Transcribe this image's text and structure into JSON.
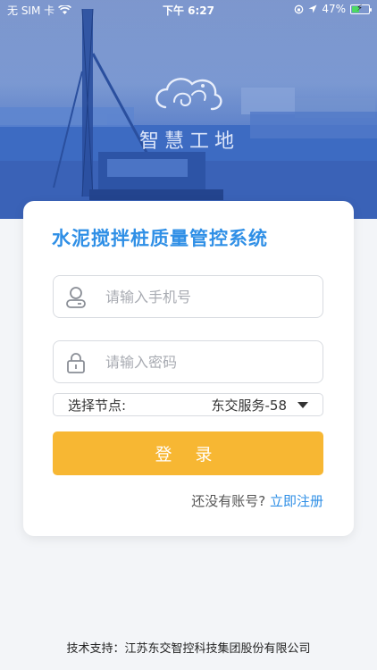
{
  "status_bar": {
    "carrier": "无 SIM 卡",
    "time": "下午 6:27",
    "battery": "47%",
    "battery_level": 0.47
  },
  "hero": {
    "brand_text": "智慧工地",
    "logo_icon": "cloud-swirl-icon"
  },
  "login": {
    "title": "水泥搅拌桩质量管控系统",
    "phone_placeholder": "请输入手机号",
    "password_placeholder": "请输入密码",
    "node_label": "选择节点:",
    "node_value": "东交服务-58",
    "login_button": "登 录",
    "no_account_text": "还没有账号?",
    "register_link": "立即注册"
  },
  "footer": {
    "support_text": "技术支持：江苏东交智控科技集团股份有限公司"
  },
  "colors": {
    "accent": "#2f8fe6",
    "button": "#f7b733",
    "hero_blue": "#4f76c6"
  }
}
